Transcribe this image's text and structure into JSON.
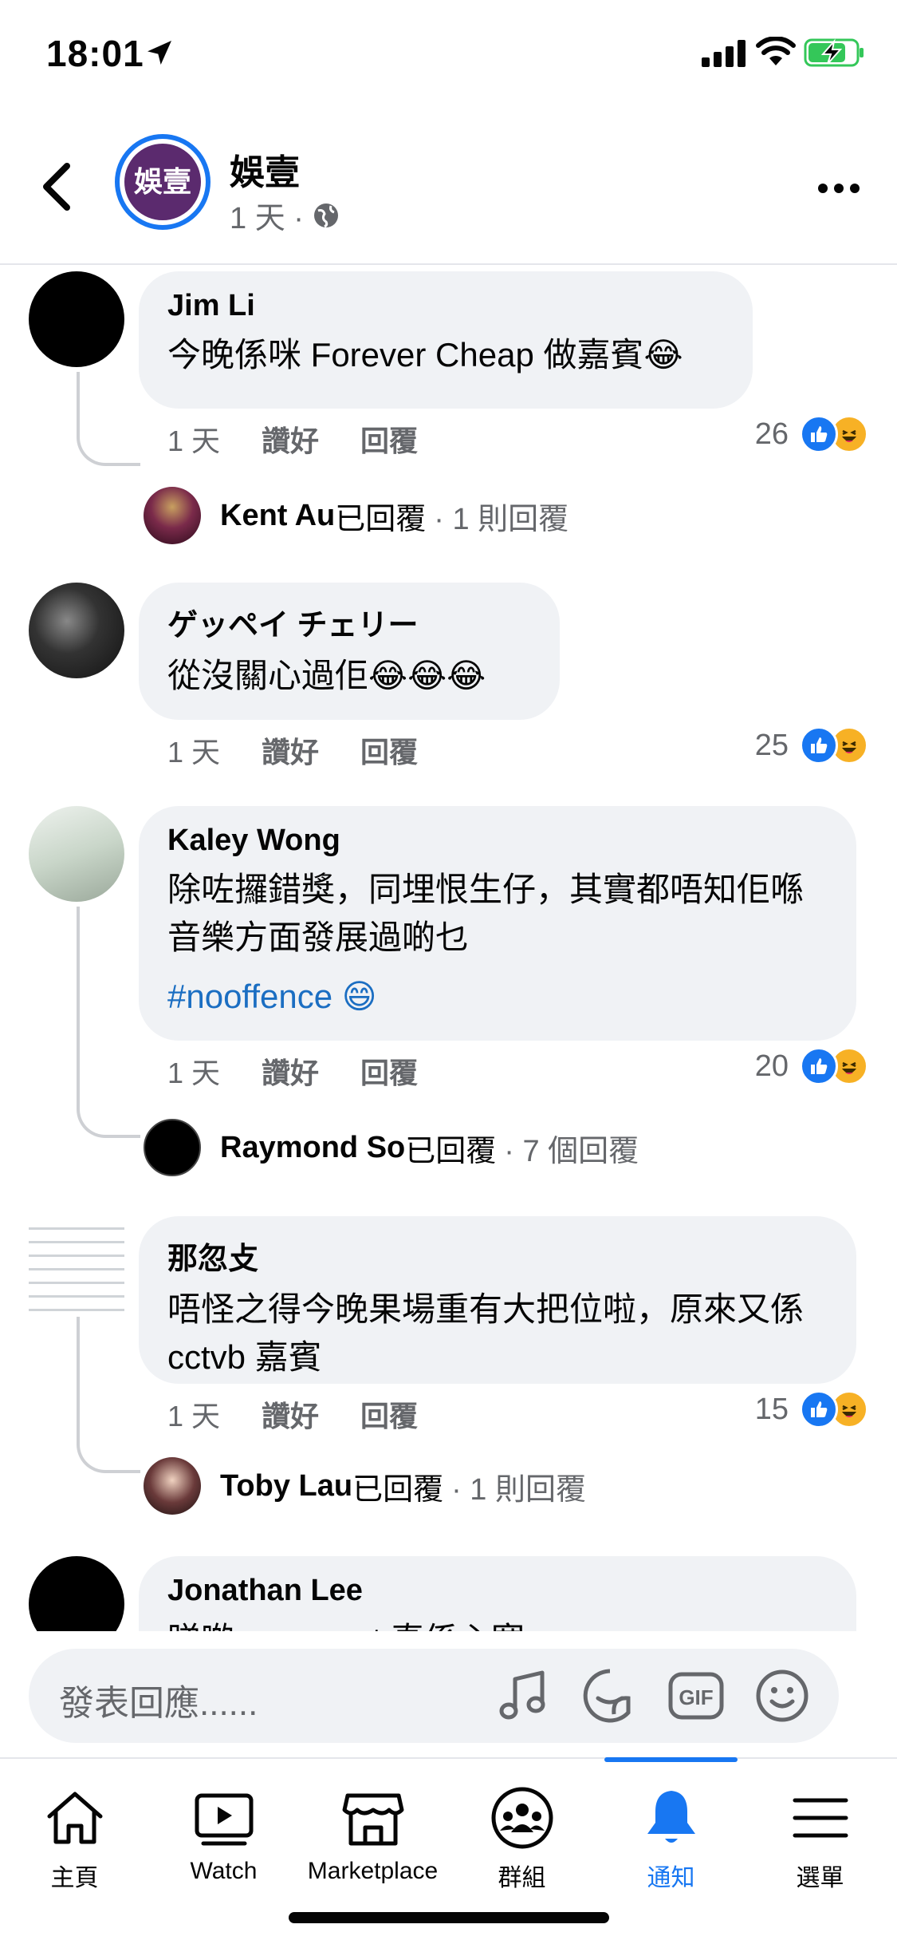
{
  "status_bar": {
    "time": "18:01"
  },
  "header": {
    "page_name": "娛壹",
    "page_avatar_text": "娛壹",
    "post_age": "1 天 ·"
  },
  "comments": [
    {
      "author": "Jim Li",
      "text": "今晚係咪 Forever Cheap 做嘉賓😂",
      "age": "1 天",
      "like_label": "讚好",
      "reply_label": "回覆",
      "reaction_count": "26",
      "reply_summary": {
        "name": "Kent Au",
        "action": "已回覆",
        "count": "· 1 則回覆"
      }
    },
    {
      "author": "ゲッペイ チェリー",
      "text": "從沒關心過佢😂😂😂",
      "age": "1 天",
      "like_label": "讚好",
      "reply_label": "回覆",
      "reaction_count": "25"
    },
    {
      "author": "Kaley Wong",
      "text": "除咗攞錯獎，同埋恨生仔，其實都唔知佢喺音樂方面發展過啲乜",
      "hashtag": "#nooffence 😄",
      "age": "1 天",
      "like_label": "讚好",
      "reply_label": "回覆",
      "reaction_count": "20",
      "reply_summary": {
        "name": "Raymond So",
        "action": "已回覆",
        "count": "· 7 個回覆"
      }
    },
    {
      "author": "那忽攴",
      "text": "唔怪之得今晚果場重有大把位啦，原來又係 cctvb 嘉賓",
      "age": "1 天",
      "like_label": "讚好",
      "reply_label": "回覆",
      "reaction_count": "15",
      "reply_summary": {
        "name": "Toby Lau",
        "action": "已回覆",
        "count": "· 1 則回覆"
      }
    },
    {
      "author": "Jonathan Lee",
      "text": "睇啲 comment 真係心寒"
    }
  ],
  "composer": {
    "placeholder": "發表回應......"
  },
  "tabs": [
    {
      "label": "主頁",
      "icon": "home-icon"
    },
    {
      "label": "Watch",
      "icon": "watch-icon"
    },
    {
      "label": "Marketplace",
      "icon": "marketplace-icon"
    },
    {
      "label": "群組",
      "icon": "groups-icon"
    },
    {
      "label": "通知",
      "icon": "bell-icon",
      "active": true
    },
    {
      "label": "選單",
      "icon": "menu-icon"
    }
  ],
  "colors": {
    "accent": "#1877f2",
    "bubble": "#f0f2f5",
    "secondary_text": "#65676b"
  }
}
